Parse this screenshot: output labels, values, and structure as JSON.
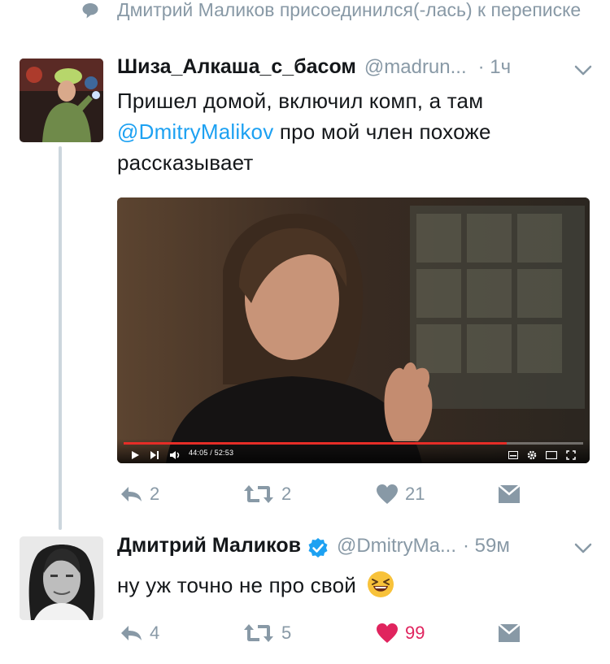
{
  "join_notice": {
    "text": "Дмитрий Маликов присоединился(-лась) к переписке"
  },
  "tweets": [
    {
      "name": "Шиза_Алкаша_с_басом",
      "handle": "@madrun...",
      "time": "· 1ч",
      "text_before": "Пришел домой, включил комп, а там ",
      "mention": "@DmitryMalikov",
      "text_after": " про мой член похоже рассказывает",
      "video": {
        "time_display": "44:05 / 52:53",
        "progress": 0.834
      },
      "actions": {
        "reply": "2",
        "retweet": "2",
        "like": "21"
      }
    },
    {
      "name": "Дмитрий Маликов",
      "handle": "@DmitryMa...",
      "time": "· 59м",
      "verified": true,
      "text": "ну уж точно не про свой",
      "emoji": "laughing-face",
      "actions": {
        "reply": "4",
        "retweet": "5",
        "like": "99",
        "liked": true
      }
    }
  ],
  "colors": {
    "name": "#14171a",
    "muted": "#8899a6",
    "link": "#1da1f2",
    "like": "#e0245e",
    "thread_line": "#ccd6dd",
    "progress": "#e52d27"
  }
}
